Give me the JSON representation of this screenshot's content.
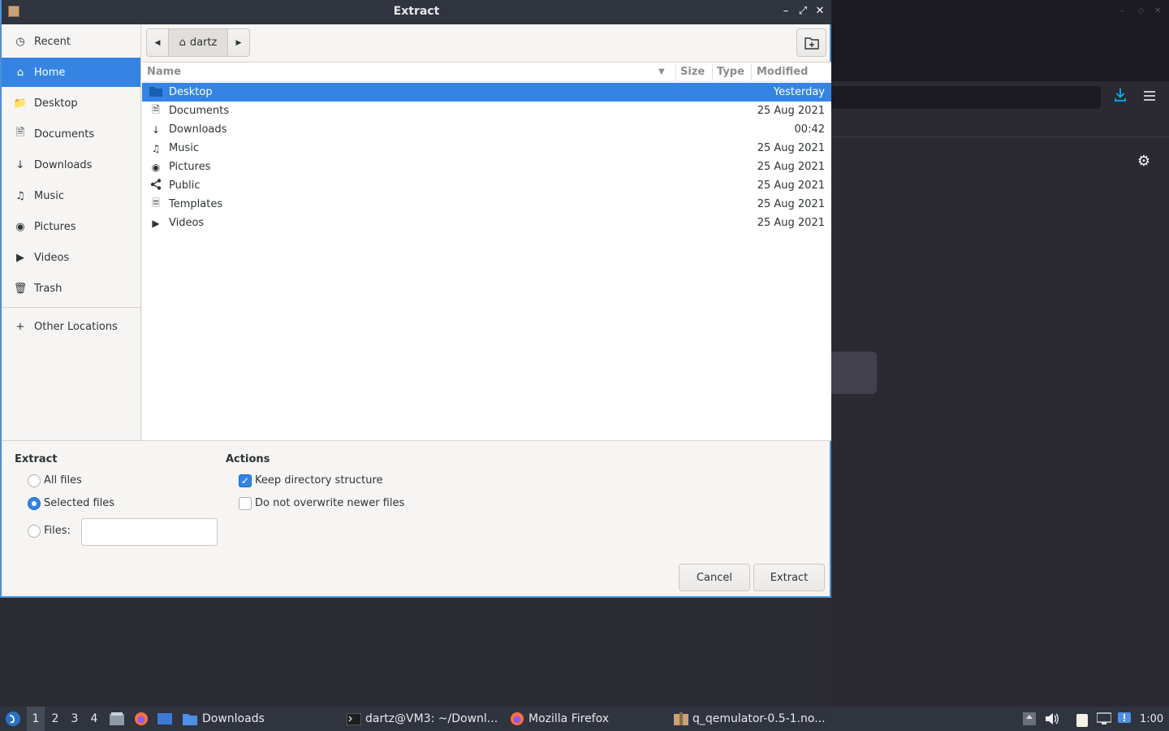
{
  "dialog": {
    "title": "Extract"
  },
  "sidebar": {
    "items": [
      {
        "label": "Recent",
        "icon": "clock-icon"
      },
      {
        "label": "Home",
        "icon": "home-icon"
      },
      {
        "label": "Desktop",
        "icon": "folder-icon"
      },
      {
        "label": "Documents",
        "icon": "document-icon"
      },
      {
        "label": "Downloads",
        "icon": "download-arrow-icon"
      },
      {
        "label": "Music",
        "icon": "music-note-icon"
      },
      {
        "label": "Pictures",
        "icon": "camera-icon"
      },
      {
        "label": "Videos",
        "icon": "video-icon"
      },
      {
        "label": "Trash",
        "icon": "trash-icon"
      }
    ],
    "other_locations": "Other Locations"
  },
  "pathbar": {
    "crumb": "dartz"
  },
  "columns": {
    "name": "Name",
    "size": "Size",
    "type": "Type",
    "modified": "Modified"
  },
  "files": [
    {
      "name": "Desktop",
      "modified": "Yesterday",
      "icon": "folder-icon"
    },
    {
      "name": "Documents",
      "modified": "25 Aug 2021",
      "icon": "document-icon"
    },
    {
      "name": "Downloads",
      "modified": "00:42",
      "icon": "download-arrow-icon"
    },
    {
      "name": "Music",
      "modified": "25 Aug 2021",
      "icon": "music-note-icon"
    },
    {
      "name": "Pictures",
      "modified": "25 Aug 2021",
      "icon": "camera-icon"
    },
    {
      "name": "Public",
      "modified": "25 Aug 2021",
      "icon": "share-icon"
    },
    {
      "name": "Templates",
      "modified": "25 Aug 2021",
      "icon": "template-icon"
    },
    {
      "name": "Videos",
      "modified": "25 Aug 2021",
      "icon": "video-icon"
    }
  ],
  "extract_section": {
    "heading": "Extract",
    "all_files": "All files",
    "selected_files": "Selected files",
    "files_label": "Files:",
    "files_value": "",
    "selected_option": "Selected files"
  },
  "actions_section": {
    "heading": "Actions",
    "keep_structure": "Keep directory structure",
    "keep_structure_checked": true,
    "no_overwrite": "Do not overwrite newer files",
    "no_overwrite_checked": false
  },
  "buttons": {
    "cancel": "Cancel",
    "extract": "Extract"
  },
  "taskbar": {
    "workspaces": [
      "1",
      "2",
      "3",
      "4"
    ],
    "active_workspace": "1",
    "tasks": [
      {
        "label": "Downloads",
        "icon": "folder-icon"
      },
      {
        "label": "dartz@VM3: ~/Downl...",
        "icon": "terminal-icon"
      },
      {
        "label": "Mozilla Firefox",
        "icon": "firefox-icon"
      },
      {
        "label": "q_qemulator-0.5-1.no...",
        "icon": "archive-icon"
      }
    ],
    "clock": "1:00"
  },
  "colors": {
    "accent": "#3584e4",
    "titlebar": "#2f343f",
    "desktop": "#2b2b33"
  }
}
